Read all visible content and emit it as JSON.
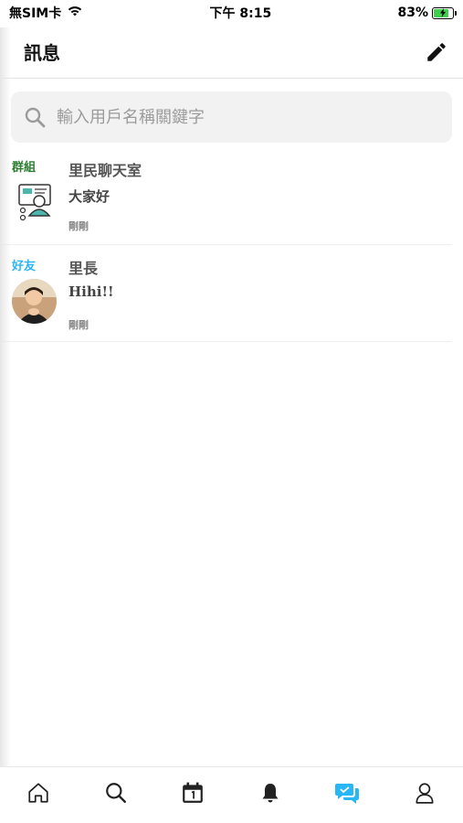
{
  "status_bar": {
    "carrier": "無SIM卡",
    "time": "下午 8:15",
    "battery_percent": "83%",
    "battery_level": 0.83
  },
  "header": {
    "title": "訊息",
    "edit_icon": "pencil-icon"
  },
  "search": {
    "placeholder": "輸入用戶名稱關鍵字",
    "value": "",
    "icon": "search-icon"
  },
  "chats": [
    {
      "tag": "群組",
      "tag_color": "#2e7d32",
      "name": "里民聊天室",
      "message": "大家好",
      "time": "剛剛"
    },
    {
      "tag": "好友",
      "tag_color": "#29b6f6",
      "name": "里長",
      "message": "Hihi!!",
      "time": "剛剛"
    }
  ],
  "tab_bar": {
    "tabs": [
      {
        "icon": "home-icon",
        "active": false
      },
      {
        "icon": "search-icon",
        "active": false
      },
      {
        "icon": "calendar-icon",
        "active": false
      },
      {
        "icon": "bell-icon",
        "active": false
      },
      {
        "icon": "chat-icon",
        "active": true
      },
      {
        "icon": "user-icon",
        "active": false
      }
    ],
    "active_color": "#29b6f6"
  }
}
